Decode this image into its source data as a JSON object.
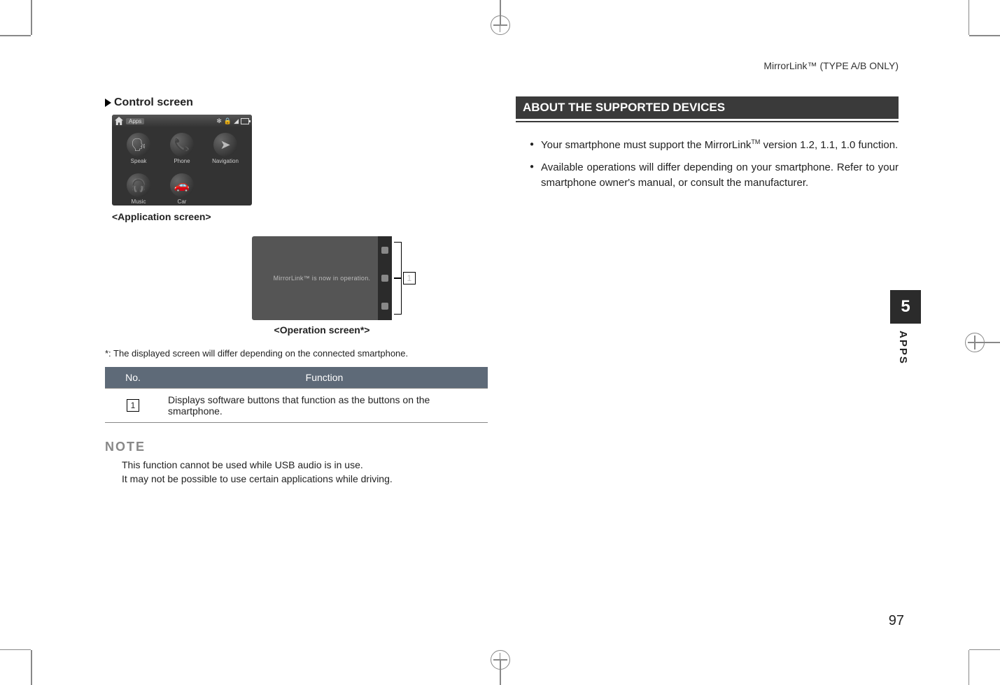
{
  "header_right": "MirrorLink™ (TYPE A/B ONLY)",
  "left": {
    "control_title": "Control screen",
    "app_screen": {
      "bar_label": "Apps",
      "icons": [
        "Speak",
        "Phone",
        "Navigation",
        "Music",
        "Car"
      ]
    },
    "app_caption": "<Application screen>",
    "op_screen_text": "MirrorLink™ is now in operation.",
    "op_caption": "<Operation screen*>",
    "footnote": "*:   The displayed screen will differ depending on the connected smartphone.",
    "table": {
      "headers": [
        "No.",
        "Function"
      ],
      "rows": [
        {
          "no": "1",
          "func": "Displays software buttons that function as the buttons on the smartphone."
        }
      ]
    },
    "note_heading": "NOTE",
    "note_lines": [
      "This function cannot be used while USB audio is in use.",
      "It may not be possible to use certain applications while driving."
    ]
  },
  "right": {
    "section_heading": "ABOUT THE SUPPORTED DEVICES",
    "bullets": [
      "Your smartphone must support the MirrorLinkTM version 1.2, 1.1, 1.0 function.",
      "Available operations will differ depending on your smartphone. Refer to your smartphone owner's manual, or consult the manufacturer."
    ]
  },
  "side_tab_number": "5",
  "side_tab_label": "APPS",
  "page_number": "97",
  "callout_number": "1"
}
